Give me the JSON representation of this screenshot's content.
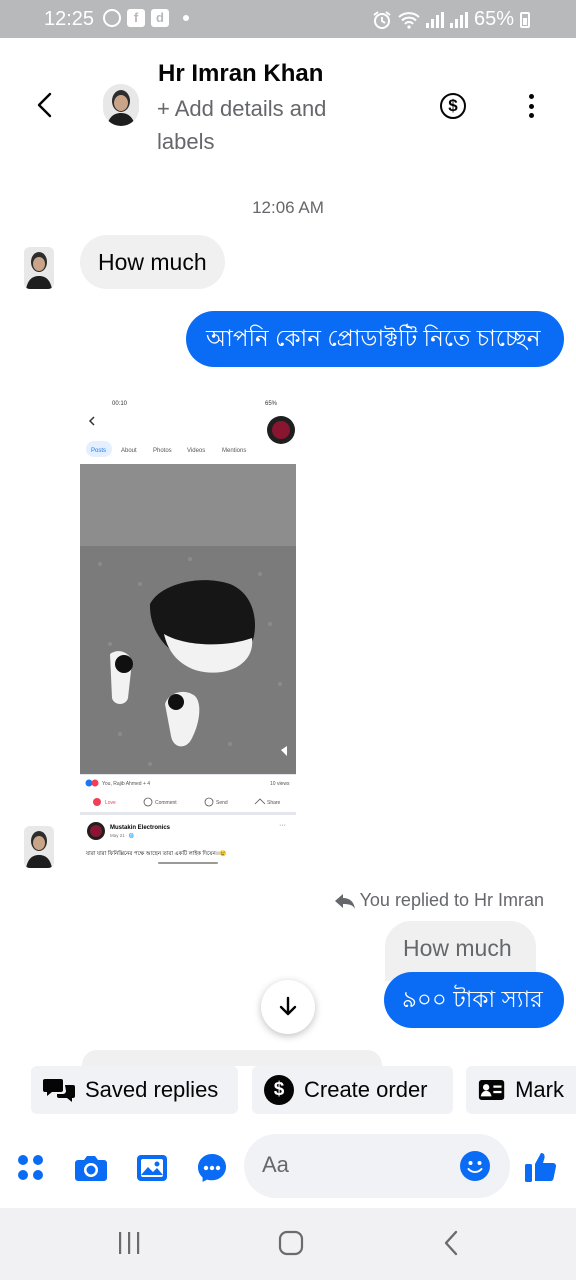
{
  "status_bar": {
    "time": "12:25",
    "battery": "65%",
    "fb_badge": "f",
    "app_badge": "d"
  },
  "header": {
    "contact_name": "Hr Imran Khan",
    "subtitle": "+ Add details and labels",
    "dollar_symbol": "$"
  },
  "conversation": {
    "timestamp": "12:06 AM",
    "messages": [
      {
        "from": "contact",
        "text": "How much"
      },
      {
        "from": "me",
        "text": "আপনি কোন প্রোডাক্টটি নিতে চাচ্ছেন"
      },
      {
        "from": "contact",
        "type": "image"
      }
    ],
    "replied_note": "You replied to Hr Imran",
    "quoted_message": "How much",
    "reply_message": "৯০০ টাকা স্যার"
  },
  "shared_screenshot": {
    "time": "00:10",
    "battery": "65%",
    "tabs": [
      "Posts",
      "About",
      "Photos",
      "Videos",
      "Mentions"
    ],
    "reactions": "You, Rajib Ahmed + 4",
    "views": "10 views",
    "actions": [
      "Love",
      "Comment",
      "Send",
      "Share"
    ],
    "page_name": "Mustakin Electronics",
    "page_date": "May 21 · 🌐",
    "post_text": "যারা যারা ফিনিক্সিনের পক্ষে আছেন তারা একটি লাইক দিয়েন।।😢"
  },
  "quick_replies": {
    "saved_replies": "Saved replies",
    "create_order": "Create order",
    "mark": "Mark"
  },
  "composer": {
    "placeholder": "Aa"
  },
  "colors": {
    "accent": "#0a6cf5",
    "incoming_bubble": "#f0f0f0",
    "status_bar": "#b8b9bb"
  }
}
